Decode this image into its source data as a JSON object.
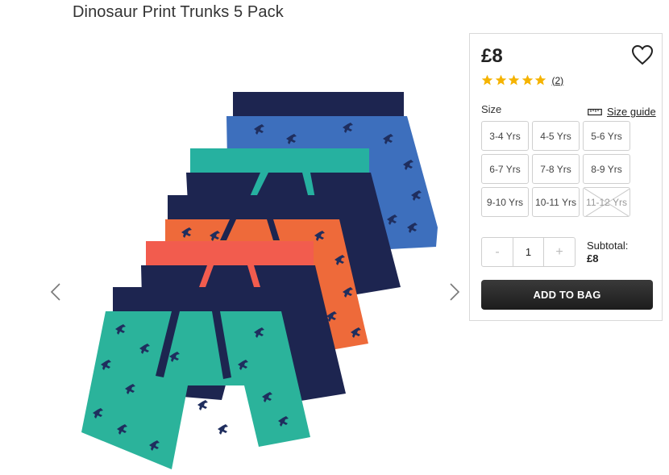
{
  "product": {
    "title": "Dinosaur Print Trunks 5 Pack"
  },
  "gallery": {
    "prev_icon": "chevron-left-icon",
    "next_icon": "chevron-right-icon"
  },
  "panel": {
    "price": "£8",
    "rating": {
      "stars": 5,
      "max": 5,
      "review_count": "(2)",
      "star_color": "#f5b301"
    },
    "size_label": "Size",
    "size_guide": "Size guide",
    "sizes": [
      {
        "label": "3-4 Yrs",
        "available": true
      },
      {
        "label": "4-5 Yrs",
        "available": true
      },
      {
        "label": "5-6 Yrs",
        "available": true
      },
      {
        "label": "6-7 Yrs",
        "available": true
      },
      {
        "label": "7-8 Yrs",
        "available": true
      },
      {
        "label": "8-9 Yrs",
        "available": true
      },
      {
        "label": "9-10 Yrs",
        "available": true
      },
      {
        "label": "10-11 Yrs",
        "available": true
      },
      {
        "label": "11-12 Yrs",
        "available": false
      }
    ],
    "quantity": {
      "minus": "-",
      "value": "1",
      "plus": "+"
    },
    "subtotal": {
      "label": "Subtotal:",
      "amount": "£8"
    },
    "add_to_bag": "ADD TO BAG"
  },
  "colors": {
    "button_dark": "#262626",
    "border": "#d9d9d9"
  }
}
